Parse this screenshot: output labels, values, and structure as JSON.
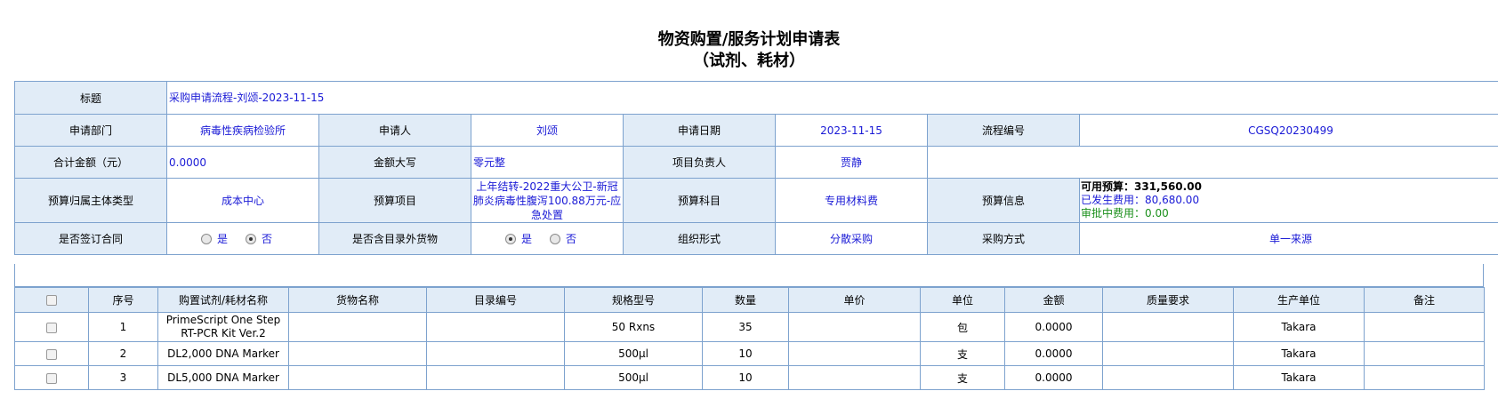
{
  "header": {
    "title_line1": "物资购置/服务计划申请表",
    "title_line2": "（试剂、耗材）"
  },
  "form": {
    "subject_label": "标题",
    "subject_value": "采购申请流程-刘颂-2023-11-15",
    "dept_label": "申请部门",
    "dept_value": "病毒性疾病检验所",
    "applicant_label": "申请人",
    "applicant_value": "刘颂",
    "date_label": "申请日期",
    "date_value": "2023-11-15",
    "flow_no_label": "流程编号",
    "flow_no_value": "CGSQ20230499",
    "total_label": "合计金额（元）",
    "total_value": "0.0000",
    "total_upper_label": "金额大写",
    "total_upper_value": "零元整",
    "pm_label": "项目负责人",
    "pm_value": "贾静",
    "budget_owner_label": "预算归属主体类型",
    "budget_owner_value": "成本中心",
    "budget_item_label": "预算项目",
    "budget_item_value": "上年结转-2022重大公卫-新冠肺炎病毒性腹泻100.88万元-应急处置",
    "budget_subject_label": "预算科目",
    "budget_subject_value": "专用材料费",
    "budget_info_label": "预算信息",
    "budget_available": "可用预算：331,560.00",
    "budget_spent": "已发生费用：80,680.00",
    "budget_pending": "审批中费用：0.00",
    "contract_label": "是否签订合同",
    "yes": "是",
    "no": "否",
    "contract_value": "否",
    "offlist_label": "是否含目录外货物",
    "offlist_value": "是",
    "org_form_label": "组织形式",
    "org_form_value": "分散采购",
    "purchase_method_label": "采购方式",
    "purchase_method_value": "单一来源"
  },
  "items_table": {
    "columns": [
      "",
      "序号",
      "购置试剂/耗材名称",
      "货物名称",
      "目录编号",
      "规格型号",
      "数量",
      "单价",
      "单位",
      "金额",
      "质量要求",
      "生产单位",
      "备注"
    ],
    "rows": [
      {
        "no": "1",
        "name": "PrimeScript One Step RT-PCR Kit Ver.2",
        "goods": "",
        "catalog": "",
        "spec": "50 Rxns",
        "qty": "35",
        "price": "",
        "unit": "包",
        "amount": "0.0000",
        "quality": "",
        "maker": "Takara",
        "note": ""
      },
      {
        "no": "2",
        "name": "DL2,000 DNA Marker",
        "goods": "",
        "catalog": "",
        "spec": "500μl",
        "qty": "10",
        "price": "",
        "unit": "支",
        "amount": "0.0000",
        "quality": "",
        "maker": "Takara",
        "note": ""
      },
      {
        "no": "3",
        "name": "DL5,000 DNA Marker",
        "goods": "",
        "catalog": "",
        "spec": "500μl",
        "qty": "10",
        "price": "",
        "unit": "支",
        "amount": "0.0000",
        "quality": "",
        "maker": "Takara",
        "note": ""
      }
    ]
  }
}
